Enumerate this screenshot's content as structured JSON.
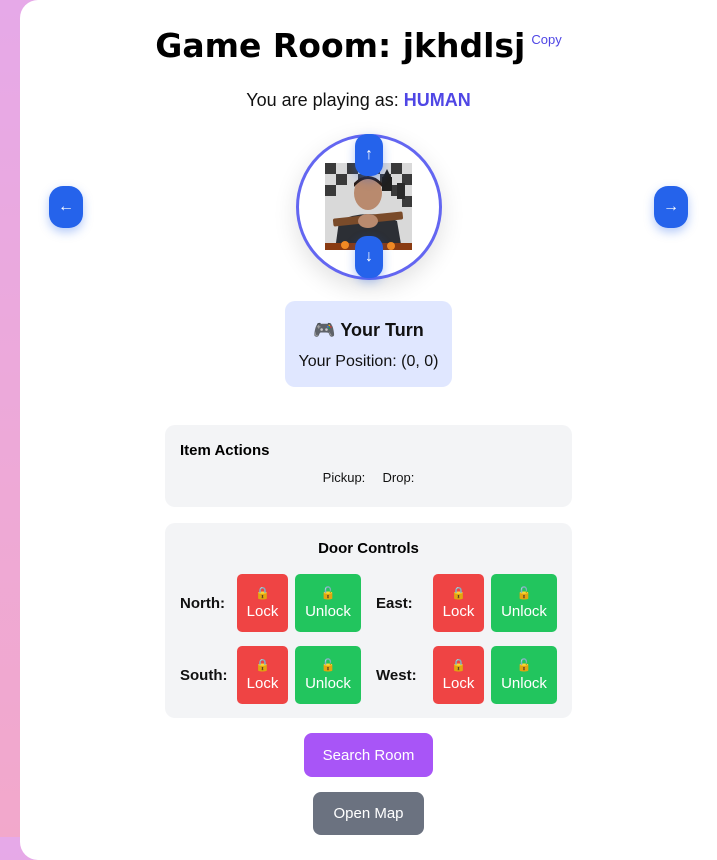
{
  "header": {
    "title": "Game Room: jkhdlsj",
    "copy_label": "Copy",
    "playing_prefix": "You are playing as:",
    "role": "HUMAN"
  },
  "navigation": {
    "left_icon": "←",
    "right_icon": "→",
    "up_icon": "↑",
    "down_icon": "↓"
  },
  "turn": {
    "icon": "🎮",
    "title": "Your Turn",
    "position_label": "Your Position: (0, 0)"
  },
  "item_actions": {
    "title": "Item Actions",
    "pickup_label": "Pickup:",
    "drop_label": "Drop:"
  },
  "door_controls": {
    "title": "Door Controls",
    "lock_icon": "🔒",
    "unlock_icon": "🔓",
    "lock_label": "Lock",
    "unlock_label": "Unlock",
    "directions": [
      "North:",
      "East:",
      "South:",
      "West:"
    ]
  },
  "actions": {
    "search_label": "Search Room",
    "map_label": "Open Map"
  },
  "colors": {
    "accent": "#4f46e5",
    "nav_blue": "#2563eb",
    "lock_red": "#ef4444",
    "unlock_green": "#22c55e",
    "search_purple": "#a855f7",
    "map_gray": "#6b7280"
  }
}
